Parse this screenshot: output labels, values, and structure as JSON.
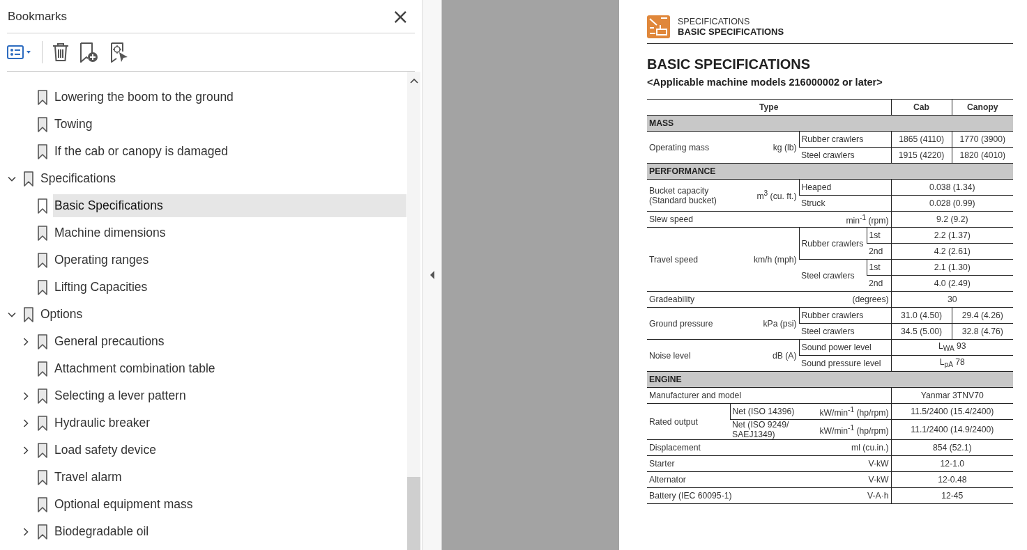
{
  "bookmarks": {
    "title": "Bookmarks",
    "close": "×",
    "continued_items": [
      {
        "label": "Lowering the boom to the ground",
        "selected": false
      },
      {
        "label": "Towing",
        "selected": false
      },
      {
        "label": "If the cab or canopy is damaged",
        "selected": false
      }
    ],
    "items": [
      {
        "label": "Specifications",
        "selected": false,
        "expanded": true,
        "children": [
          {
            "label": "Basic Specifications",
            "selected": true
          },
          {
            "label": "Machine dimensions",
            "selected": false
          },
          {
            "label": "Operating ranges",
            "selected": false
          },
          {
            "label": "Lifting Capacities",
            "selected": false
          }
        ]
      },
      {
        "label": "Options",
        "selected": false,
        "expanded": true,
        "children": [
          {
            "label": "General precautions",
            "selected": false,
            "expanded": false
          },
          {
            "label": "Attachment combination table",
            "selected": false
          },
          {
            "label": "Selecting a lever pattern",
            "selected": false,
            "expanded": false
          },
          {
            "label": "Hydraulic breaker",
            "selected": false,
            "expanded": false
          },
          {
            "label": "Load safety device",
            "selected": false,
            "expanded": false
          },
          {
            "label": "Travel alarm",
            "selected": false
          },
          {
            "label": "Optional equipment mass",
            "selected": false
          },
          {
            "label": "Biodegradable oil",
            "selected": false,
            "expanded": false
          }
        ]
      }
    ]
  },
  "page": {
    "section": "SPECIFICATIONS",
    "subsection": "BASIC SPECIFICATIONS",
    "heading": "BASIC SPECIFICATIONS",
    "subtitle": "<Applicable machine models 216000002 or later>",
    "table": {
      "columns": [
        "Type",
        "Cab",
        "Canopy"
      ],
      "sections": [
        {
          "title": "MASS",
          "items": [
            {
              "label": "Operating mass",
              "unit": "kg (lb)",
              "rows": [
                {
                  "sub": "Rubber crawlers",
                  "cab": "1865 (4110)",
                  "canopy": "1770 (3900)"
                },
                {
                  "sub": "Steel crawlers",
                  "cab": "1915 (4220)",
                  "canopy": "1820 (4010)"
                }
              ]
            }
          ]
        },
        {
          "title": "PERFORMANCE",
          "items": [
            {
              "label": "Bucket capacity\n(Standard bucket)",
              "unit": "m$^{3}$ (cu. ft.)",
              "rows": [
                {
                  "sub": "Heaped",
                  "value": "0.038 (1.34)"
                },
                {
                  "sub": "Struck",
                  "value": "0.028 (0.99)"
                }
              ]
            },
            {
              "label": "Slew speed",
              "unit": "min$^{-1}$ (rpm)",
              "value": "9.2 (9.2)"
            },
            {
              "label": "Travel speed",
              "unit": "km/h (mph)",
              "groups": [
                {
                  "sub": "Rubber crawlers",
                  "gears": [
                    {
                      "gear": "1st",
                      "value": "2.2 (1.37)"
                    },
                    {
                      "gear": "2nd",
                      "value": "4.2 (2.61)"
                    }
                  ]
                },
                {
                  "sub": "Steel crawlers",
                  "gears": [
                    {
                      "gear": "1st",
                      "value": "2.1 (1.30)"
                    },
                    {
                      "gear": "2nd",
                      "value": "4.0 (2.49)"
                    }
                  ]
                }
              ]
            },
            {
              "label": "Gradeability",
              "unit": "(degrees)",
              "value": "30"
            },
            {
              "label": "Ground pressure",
              "unit": "kPa (psi)",
              "rows": [
                {
                  "sub": "Rubber crawlers",
                  "cab": "31.0 (4.50)",
                  "canopy": "29.4 (4.26)"
                },
                {
                  "sub": "Steel crawlers",
                  "cab": "34.5 (5.00)",
                  "canopy": "32.8 (4.76)"
                }
              ]
            },
            {
              "label": "Noise level",
              "unit": "dB (A)",
              "rows": [
                {
                  "sub": "Sound power level",
                  "value": "L$_{WA}$ 93"
                },
                {
                  "sub": "Sound pressure level",
                  "value": "L$_{pA}$ 78"
                }
              ]
            }
          ]
        },
        {
          "title": "ENGINE",
          "items": [
            {
              "label": "Manufacturer and model",
              "value": "Yanmar 3TNV70"
            },
            {
              "label": "Rated output",
              "rows": [
                {
                  "sub": "Net (ISO 14396)",
                  "sub_unit": "kW/min$^{-1}$ (hp/rpm)",
                  "value": "11.5/2400 (15.4/2400)"
                },
                {
                  "sub": "Net (ISO 9249/\nSAEJ1349)",
                  "sub_unit": "kW/min$^{-1}$ (hp/rpm)",
                  "value": "11.1/2400 (14.9/2400)"
                }
              ]
            },
            {
              "label": "Displacement",
              "unit": "ml (cu.in.)",
              "value": "854 (52.1)"
            },
            {
              "label": "Starter",
              "unit": "V-kW",
              "value": "12-1.0"
            },
            {
              "label": "Alternator",
              "unit": "V-kW",
              "value": "12-0.48"
            },
            {
              "label": "Battery (IEC 60095-1)",
              "unit": "V-A·h",
              "value": "12-45"
            }
          ]
        }
      ]
    }
  }
}
